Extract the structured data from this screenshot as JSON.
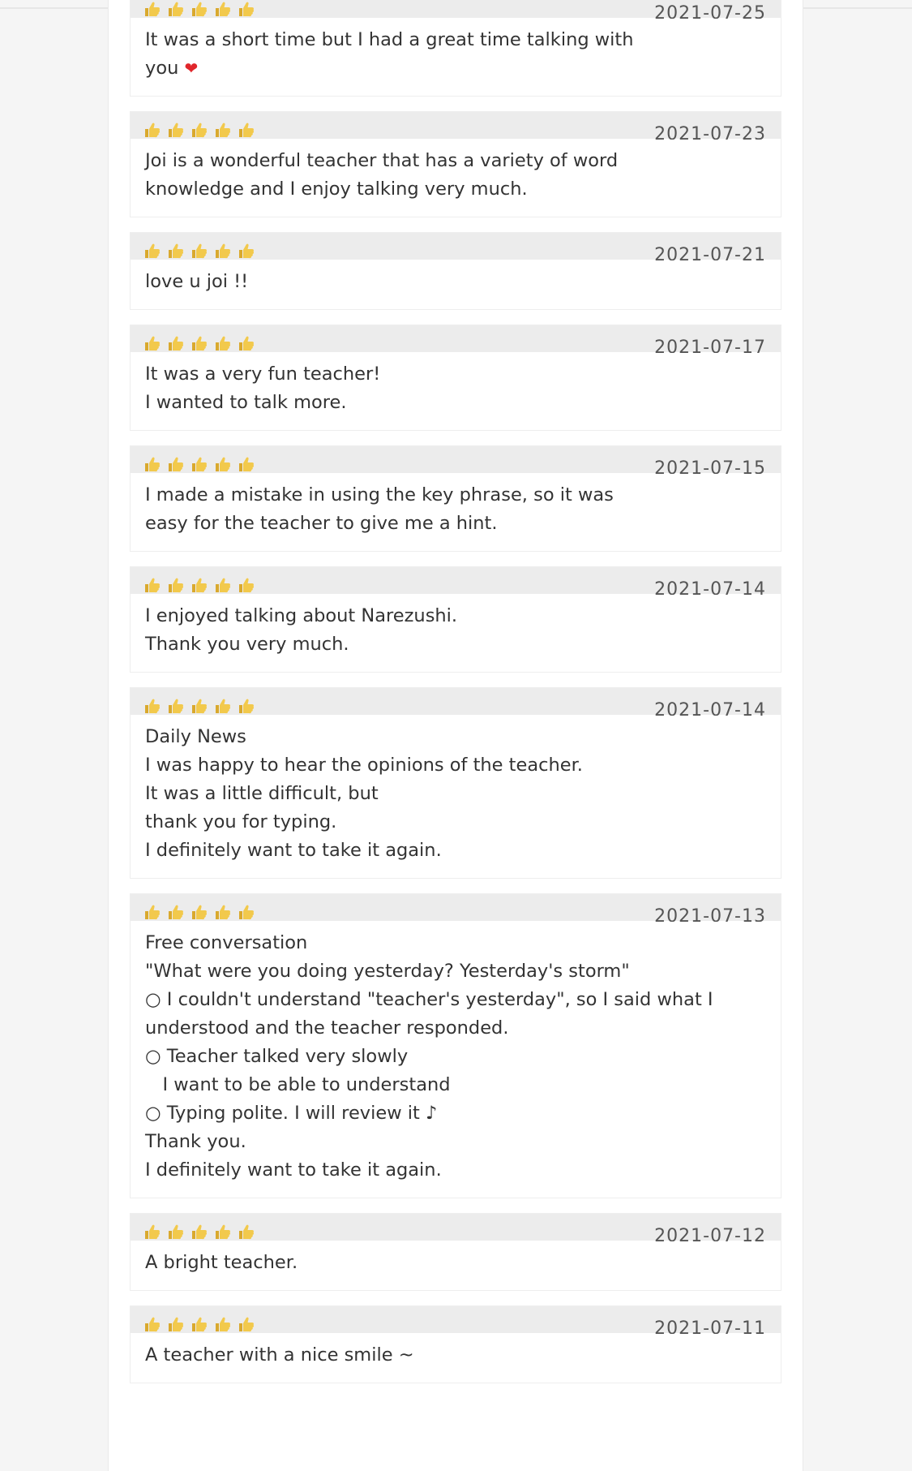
{
  "reviews": [
    {
      "date": "2021-07-25",
      "comment": "It was a short time but I had a great time talking with\nyou ",
      "emoji": "❤",
      "rating": 5
    },
    {
      "date": "2021-07-23",
      "comment": "Joi is a wonderful teacher that has a variety of word\nknowledge and I enjoy talking very much.",
      "rating": 5
    },
    {
      "date": "2021-07-21",
      "comment": "love u joi !!",
      "rating": 5
    },
    {
      "date": "2021-07-17",
      "comment": "It was a very fun teacher!\nI wanted to talk more.",
      "rating": 5
    },
    {
      "date": "2021-07-15",
      "comment": "I made a mistake in using the key phrase, so it was\neasy for the teacher to give me a hint.",
      "rating": 5
    },
    {
      "date": "2021-07-14",
      "comment": "I enjoyed talking about Narezushi.\nThank you very much.",
      "rating": 5
    },
    {
      "date": "2021-07-14",
      "comment": "Daily News\nI was happy to hear the opinions of the teacher.\nIt was a little difficult, but\nthank you for typing.\nI definitely want to take it again.",
      "rating": 5
    },
    {
      "date": "2021-07-13",
      "comment": "Free conversation\n\"What were you doing yesterday? Yesterday's storm\"\n○ I couldn't understand \"teacher's yesterday\", so I said what I\nunderstood and the teacher responded.\n○ Teacher talked very slowly\n   I want to be able to understand\n○ Typing polite. I will review it ♪\nThank you.\nI definitely want to take it again.",
      "rating": 5
    },
    {
      "date": "2021-07-12",
      "comment": "A bright teacher.",
      "rating": 5
    },
    {
      "date": "2021-07-11",
      "comment": "A teacher with a nice smile ~",
      "rating": 5
    }
  ],
  "colors": {
    "thumb": "#f2c94c",
    "thumb_cuff": "#d9a92e",
    "header_bg": "#ececec",
    "heart": "#e0262b"
  },
  "icons": {
    "rating": "thumbs-up-icon"
  }
}
